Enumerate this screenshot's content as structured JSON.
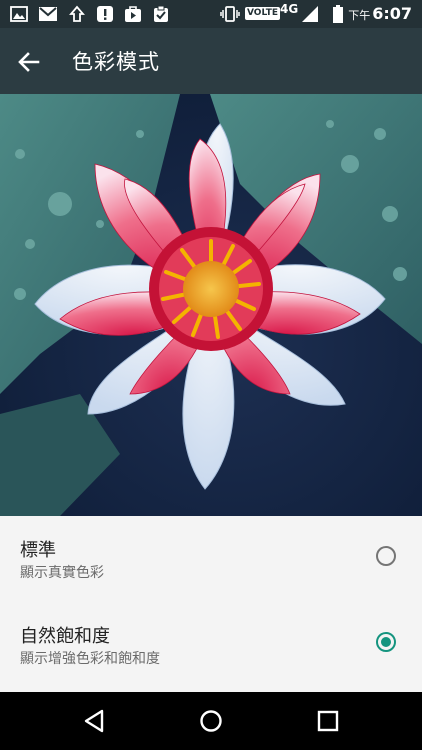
{
  "status_bar": {
    "network_label": "VOLTE",
    "network_type": "4G",
    "time_prefix": "下午",
    "time": "6:07",
    "icons": [
      "photo-icon",
      "gmail-icon",
      "upload-icon",
      "alert-icon",
      "play-store-icon",
      "clipboard-check-icon",
      "vibrate-icon",
      "signal-icon",
      "battery-icon"
    ]
  },
  "app_bar": {
    "title": "色彩模式",
    "back_icon": "arrow-back-icon"
  },
  "options": [
    {
      "title": "標準",
      "subtitle": "顯示真實色彩",
      "selected": false
    },
    {
      "title": "自然飽和度",
      "subtitle": "顯示增強色彩和飽和度",
      "selected": true
    }
  ],
  "colors": {
    "accent": "#14947f",
    "app_bar": "#2c3c42",
    "status_bar": "#243136"
  },
  "nav_bar": {
    "icons": [
      "back-triangle-icon",
      "home-circle-icon",
      "recents-square-icon"
    ]
  }
}
